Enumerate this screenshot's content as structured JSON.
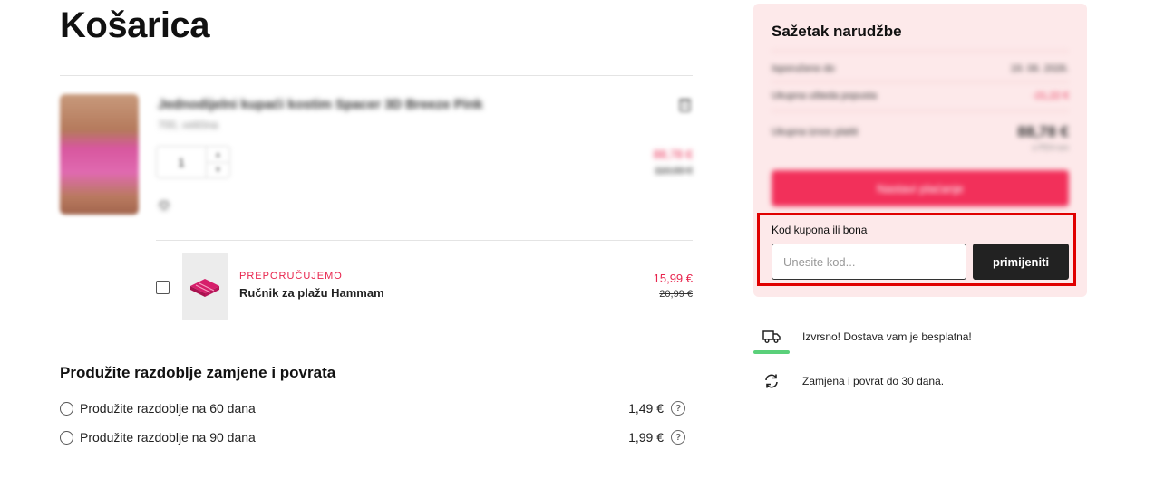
{
  "page": {
    "title": "Košarica"
  },
  "cart_item": {
    "name": "Jednodijelni kupaći kostim Spacer 3D Breeze Pink",
    "variant": "700, veličina",
    "quantity": "1",
    "price_new": "88,78 €",
    "price_old": "110,00 €"
  },
  "recommended": {
    "tag": "PREPORUČUJEMO",
    "name": "Ručnik za plažu Hammam",
    "price": "15,99 €",
    "old_price": "20,99 €"
  },
  "extension": {
    "title": "Produžite razdoblje zamjene i povrata",
    "options": [
      {
        "label": "Produžite razdoblje na 60 dana",
        "price": "1,49 €"
      },
      {
        "label": "Produžite razdoblje na 90 dana",
        "price": "1,99 €"
      }
    ]
  },
  "summary": {
    "title": "Sažetak narudžbe",
    "rows": [
      {
        "label": "Isporučeno do",
        "value": "19. 06. 2026."
      },
      {
        "label": "Ukupna ušteda popusta",
        "value": "-21,22 €"
      },
      {
        "label": "Ukupna iznos platiti",
        "value": "88,78 €"
      }
    ],
    "vat_note": "s PDV-om",
    "checkout_label": "Nastavi plaćanje",
    "coupon_label": "Kod kupona ili bona",
    "coupon_placeholder": "Unesite kod...",
    "apply_label": "primijeniti"
  },
  "perks": [
    {
      "icon": "truck-icon",
      "text": "Izvrsno! Dostava vam je besplatna!"
    },
    {
      "icon": "exchange-icon",
      "text": "Zamjena i povrat do 30 dana."
    }
  ],
  "colors": {
    "accent": "#e8244d",
    "summary_bg": "#fde9ea",
    "highlight": "#e00000",
    "progress": "#5ad07a"
  }
}
